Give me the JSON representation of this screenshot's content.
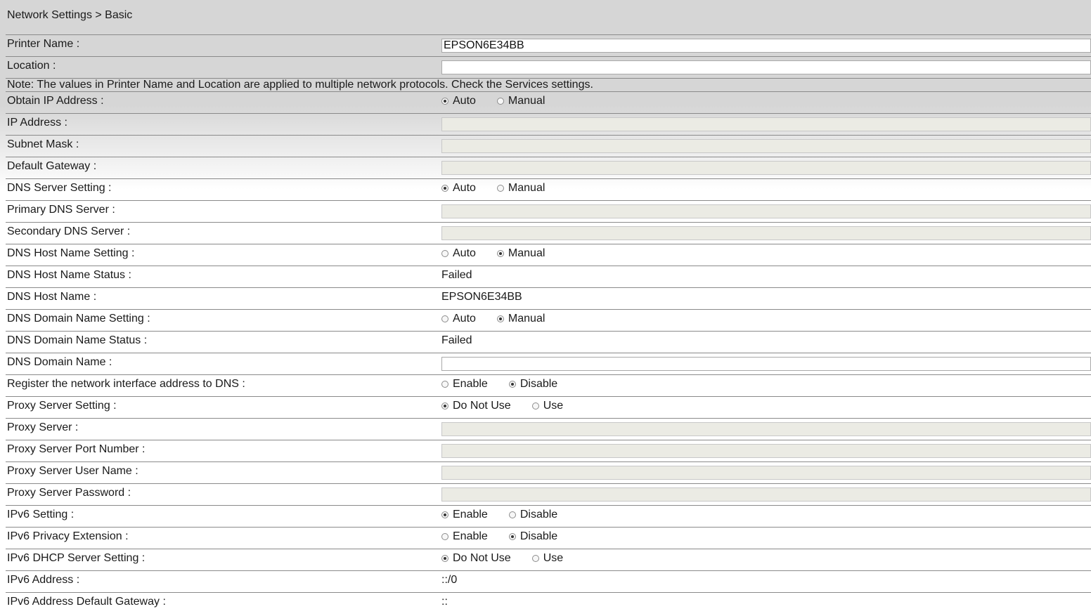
{
  "breadcrumb": "Network Settings > Basic",
  "printer_name": {
    "label": "Printer Name :",
    "value": "EPSON6E34BB"
  },
  "location": {
    "label": "Location :",
    "value": ""
  },
  "note": "Note: The values in Printer Name and Location are applied to multiple network protocols. Check the Services settings.",
  "obtain_ip": {
    "label": "Obtain IP Address :",
    "opt1": "Auto",
    "opt2": "Manual",
    "selected": "Auto"
  },
  "ip_address": {
    "label": "IP Address :",
    "value": ""
  },
  "subnet_mask": {
    "label": "Subnet Mask :",
    "value": ""
  },
  "default_gateway": {
    "label": "Default Gateway :",
    "value": ""
  },
  "dns_server_setting": {
    "label": "DNS Server Setting :",
    "opt1": "Auto",
    "opt2": "Manual",
    "selected": "Auto"
  },
  "primary_dns": {
    "label": "Primary DNS Server :",
    "value": ""
  },
  "secondary_dns": {
    "label": "Secondary DNS Server :",
    "value": ""
  },
  "dns_host_name_setting": {
    "label": "DNS Host Name Setting :",
    "opt1": "Auto",
    "opt2": "Manual",
    "selected": "Manual"
  },
  "dns_host_name_status": {
    "label": "DNS Host Name Status :",
    "value": "Failed"
  },
  "dns_host_name": {
    "label": "DNS Host Name :",
    "value": "EPSON6E34BB"
  },
  "dns_domain_name_setting": {
    "label": "DNS Domain Name Setting :",
    "opt1": "Auto",
    "opt2": "Manual",
    "selected": "Manual"
  },
  "dns_domain_name_status": {
    "label": "DNS Domain Name Status :",
    "value": "Failed"
  },
  "dns_domain_name": {
    "label": "DNS Domain Name :",
    "value": ""
  },
  "register_dns": {
    "label": "Register the network interface address to DNS :",
    "opt1": "Enable",
    "opt2": "Disable",
    "selected": "Disable"
  },
  "proxy_setting": {
    "label": "Proxy Server Setting :",
    "opt1": "Do Not Use",
    "opt2": "Use",
    "selected": "Do Not Use"
  },
  "proxy_server": {
    "label": "Proxy Server :",
    "value": ""
  },
  "proxy_port": {
    "label": "Proxy Server Port Number :",
    "value": ""
  },
  "proxy_user": {
    "label": "Proxy Server User Name :",
    "value": ""
  },
  "proxy_password": {
    "label": "Proxy Server Password :",
    "value": ""
  },
  "ipv6_setting": {
    "label": "IPv6 Setting :",
    "opt1": "Enable",
    "opt2": "Disable",
    "selected": "Enable"
  },
  "ipv6_privacy": {
    "label": "IPv6 Privacy Extension :",
    "opt1": "Enable",
    "opt2": "Disable",
    "selected": "Disable"
  },
  "ipv6_dhcp": {
    "label": "IPv6 DHCP Server Setting :",
    "opt1": "Do Not Use",
    "opt2": "Use",
    "selected": "Do Not Use"
  },
  "ipv6_address": {
    "label": "IPv6 Address :",
    "value": "::/0"
  },
  "ipv6_gateway": {
    "label": "IPv6 Address Default Gateway :",
    "value": "::"
  }
}
